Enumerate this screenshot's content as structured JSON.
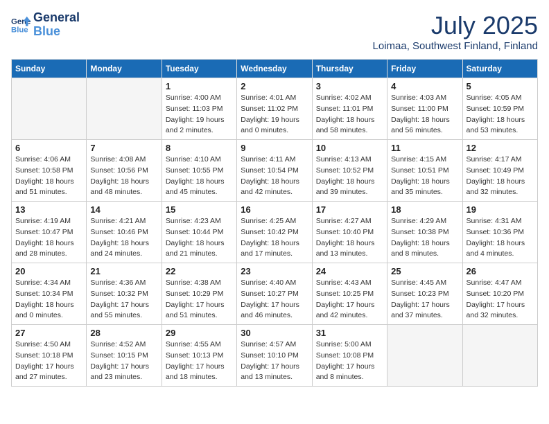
{
  "header": {
    "logo_line1": "General",
    "logo_line2": "Blue",
    "month": "July 2025",
    "location": "Loimaa, Southwest Finland, Finland"
  },
  "weekdays": [
    "Sunday",
    "Monday",
    "Tuesday",
    "Wednesday",
    "Thursday",
    "Friday",
    "Saturday"
  ],
  "weeks": [
    [
      {
        "day": "",
        "info": ""
      },
      {
        "day": "",
        "info": ""
      },
      {
        "day": "1",
        "info": "Sunrise: 4:00 AM\nSunset: 11:03 PM\nDaylight: 19 hours\nand 2 minutes."
      },
      {
        "day": "2",
        "info": "Sunrise: 4:01 AM\nSunset: 11:02 PM\nDaylight: 19 hours\nand 0 minutes."
      },
      {
        "day": "3",
        "info": "Sunrise: 4:02 AM\nSunset: 11:01 PM\nDaylight: 18 hours\nand 58 minutes."
      },
      {
        "day": "4",
        "info": "Sunrise: 4:03 AM\nSunset: 11:00 PM\nDaylight: 18 hours\nand 56 minutes."
      },
      {
        "day": "5",
        "info": "Sunrise: 4:05 AM\nSunset: 10:59 PM\nDaylight: 18 hours\nand 53 minutes."
      }
    ],
    [
      {
        "day": "6",
        "info": "Sunrise: 4:06 AM\nSunset: 10:58 PM\nDaylight: 18 hours\nand 51 minutes."
      },
      {
        "day": "7",
        "info": "Sunrise: 4:08 AM\nSunset: 10:56 PM\nDaylight: 18 hours\nand 48 minutes."
      },
      {
        "day": "8",
        "info": "Sunrise: 4:10 AM\nSunset: 10:55 PM\nDaylight: 18 hours\nand 45 minutes."
      },
      {
        "day": "9",
        "info": "Sunrise: 4:11 AM\nSunset: 10:54 PM\nDaylight: 18 hours\nand 42 minutes."
      },
      {
        "day": "10",
        "info": "Sunrise: 4:13 AM\nSunset: 10:52 PM\nDaylight: 18 hours\nand 39 minutes."
      },
      {
        "day": "11",
        "info": "Sunrise: 4:15 AM\nSunset: 10:51 PM\nDaylight: 18 hours\nand 35 minutes."
      },
      {
        "day": "12",
        "info": "Sunrise: 4:17 AM\nSunset: 10:49 PM\nDaylight: 18 hours\nand 32 minutes."
      }
    ],
    [
      {
        "day": "13",
        "info": "Sunrise: 4:19 AM\nSunset: 10:47 PM\nDaylight: 18 hours\nand 28 minutes."
      },
      {
        "day": "14",
        "info": "Sunrise: 4:21 AM\nSunset: 10:46 PM\nDaylight: 18 hours\nand 24 minutes."
      },
      {
        "day": "15",
        "info": "Sunrise: 4:23 AM\nSunset: 10:44 PM\nDaylight: 18 hours\nand 21 minutes."
      },
      {
        "day": "16",
        "info": "Sunrise: 4:25 AM\nSunset: 10:42 PM\nDaylight: 18 hours\nand 17 minutes."
      },
      {
        "day": "17",
        "info": "Sunrise: 4:27 AM\nSunset: 10:40 PM\nDaylight: 18 hours\nand 13 minutes."
      },
      {
        "day": "18",
        "info": "Sunrise: 4:29 AM\nSunset: 10:38 PM\nDaylight: 18 hours\nand 8 minutes."
      },
      {
        "day": "19",
        "info": "Sunrise: 4:31 AM\nSunset: 10:36 PM\nDaylight: 18 hours\nand 4 minutes."
      }
    ],
    [
      {
        "day": "20",
        "info": "Sunrise: 4:34 AM\nSunset: 10:34 PM\nDaylight: 18 hours\nand 0 minutes."
      },
      {
        "day": "21",
        "info": "Sunrise: 4:36 AM\nSunset: 10:32 PM\nDaylight: 17 hours\nand 55 minutes."
      },
      {
        "day": "22",
        "info": "Sunrise: 4:38 AM\nSunset: 10:29 PM\nDaylight: 17 hours\nand 51 minutes."
      },
      {
        "day": "23",
        "info": "Sunrise: 4:40 AM\nSunset: 10:27 PM\nDaylight: 17 hours\nand 46 minutes."
      },
      {
        "day": "24",
        "info": "Sunrise: 4:43 AM\nSunset: 10:25 PM\nDaylight: 17 hours\nand 42 minutes."
      },
      {
        "day": "25",
        "info": "Sunrise: 4:45 AM\nSunset: 10:23 PM\nDaylight: 17 hours\nand 37 minutes."
      },
      {
        "day": "26",
        "info": "Sunrise: 4:47 AM\nSunset: 10:20 PM\nDaylight: 17 hours\nand 32 minutes."
      }
    ],
    [
      {
        "day": "27",
        "info": "Sunrise: 4:50 AM\nSunset: 10:18 PM\nDaylight: 17 hours\nand 27 minutes."
      },
      {
        "day": "28",
        "info": "Sunrise: 4:52 AM\nSunset: 10:15 PM\nDaylight: 17 hours\nand 23 minutes."
      },
      {
        "day": "29",
        "info": "Sunrise: 4:55 AM\nSunset: 10:13 PM\nDaylight: 17 hours\nand 18 minutes."
      },
      {
        "day": "30",
        "info": "Sunrise: 4:57 AM\nSunset: 10:10 PM\nDaylight: 17 hours\nand 13 minutes."
      },
      {
        "day": "31",
        "info": "Sunrise: 5:00 AM\nSunset: 10:08 PM\nDaylight: 17 hours\nand 8 minutes."
      },
      {
        "day": "",
        "info": ""
      },
      {
        "day": "",
        "info": ""
      }
    ]
  ]
}
